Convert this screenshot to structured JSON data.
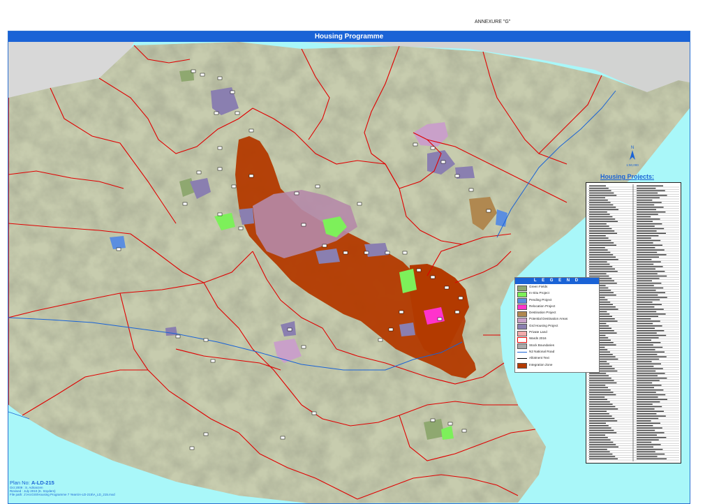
{
  "annexure": "ANNEXURE \"G\"",
  "map_title": "Housing Programme",
  "north_arrow": {
    "icon": "north-arrow-icon",
    "scale": "1:50,000"
  },
  "housing_projects": {
    "title": "Housing Projects:"
  },
  "legend": {
    "title": "L E G E N D",
    "items": [
      {
        "label": "Green Fields",
        "color": "#8fa870",
        "kind": "box"
      },
      {
        "label": "In-Situ Project",
        "color": "#7df05a",
        "kind": "box"
      },
      {
        "label": "Pending Project",
        "color": "#5b8ee0",
        "kind": "box"
      },
      {
        "label": "Relocation Project",
        "color": "#ff33cc",
        "kind": "box"
      },
      {
        "label": "Destination Project",
        "color": "#b08850",
        "kind": "box"
      },
      {
        "label": "Potential Destination Areas",
        "color": "#c9a0c9",
        "kind": "box"
      },
      {
        "label": "Grd Housing Project",
        "color": "#8a7fb0",
        "kind": "box"
      },
      {
        "label": "Private Land",
        "color": "#f2aaaa",
        "kind": "box"
      },
      {
        "label": "Wards 2016",
        "color": "#e00000",
        "kind": "outline"
      },
      {
        "label": "Stock Boundaries",
        "color": "#aaaaaa",
        "kind": "box"
      },
      {
        "label": "N2 National Road",
        "color": "#1a63d6",
        "kind": "line"
      },
      {
        "label": "Allotment Text",
        "color": "#000000",
        "kind": "line"
      },
      {
        "label": "Integration Zone",
        "color": "#b33a00",
        "kind": "box"
      }
    ]
  },
  "plan": {
    "prefix": "Plan No:",
    "number": "A-LD-215",
    "line1": "Oct 2009 : S. Adrianzen",
    "line2": "Revised : July 2010 (K. Snyders)",
    "line3": "File path: J:\\ArcGIS\\Housing Programme 7 Years\\A-LD-215\\A_LD_215.mxd"
  },
  "colors": {
    "sea": "#a9f7f9",
    "land": "#c7ccae",
    "ward": "#e00000",
    "road": "#1a63d6",
    "zone": "#b33a00"
  }
}
